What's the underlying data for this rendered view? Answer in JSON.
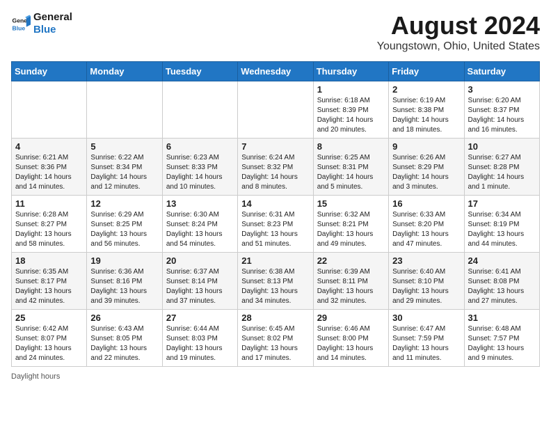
{
  "logo": {
    "line1": "General",
    "line2": "Blue"
  },
  "title": "August 2024",
  "location": "Youngstown, Ohio, United States",
  "weekdays": [
    "Sunday",
    "Monday",
    "Tuesday",
    "Wednesday",
    "Thursday",
    "Friday",
    "Saturday"
  ],
  "footer_label": "Daylight hours",
  "weeks": [
    [
      {
        "day": "",
        "info": ""
      },
      {
        "day": "",
        "info": ""
      },
      {
        "day": "",
        "info": ""
      },
      {
        "day": "",
        "info": ""
      },
      {
        "day": "1",
        "info": "Sunrise: 6:18 AM\nSunset: 8:39 PM\nDaylight: 14 hours\nand 20 minutes."
      },
      {
        "day": "2",
        "info": "Sunrise: 6:19 AM\nSunset: 8:38 PM\nDaylight: 14 hours\nand 18 minutes."
      },
      {
        "day": "3",
        "info": "Sunrise: 6:20 AM\nSunset: 8:37 PM\nDaylight: 14 hours\nand 16 minutes."
      }
    ],
    [
      {
        "day": "4",
        "info": "Sunrise: 6:21 AM\nSunset: 8:36 PM\nDaylight: 14 hours\nand 14 minutes."
      },
      {
        "day": "5",
        "info": "Sunrise: 6:22 AM\nSunset: 8:34 PM\nDaylight: 14 hours\nand 12 minutes."
      },
      {
        "day": "6",
        "info": "Sunrise: 6:23 AM\nSunset: 8:33 PM\nDaylight: 14 hours\nand 10 minutes."
      },
      {
        "day": "7",
        "info": "Sunrise: 6:24 AM\nSunset: 8:32 PM\nDaylight: 14 hours\nand 8 minutes."
      },
      {
        "day": "8",
        "info": "Sunrise: 6:25 AM\nSunset: 8:31 PM\nDaylight: 14 hours\nand 5 minutes."
      },
      {
        "day": "9",
        "info": "Sunrise: 6:26 AM\nSunset: 8:29 PM\nDaylight: 14 hours\nand 3 minutes."
      },
      {
        "day": "10",
        "info": "Sunrise: 6:27 AM\nSunset: 8:28 PM\nDaylight: 14 hours\nand 1 minute."
      }
    ],
    [
      {
        "day": "11",
        "info": "Sunrise: 6:28 AM\nSunset: 8:27 PM\nDaylight: 13 hours\nand 58 minutes."
      },
      {
        "day": "12",
        "info": "Sunrise: 6:29 AM\nSunset: 8:25 PM\nDaylight: 13 hours\nand 56 minutes."
      },
      {
        "day": "13",
        "info": "Sunrise: 6:30 AM\nSunset: 8:24 PM\nDaylight: 13 hours\nand 54 minutes."
      },
      {
        "day": "14",
        "info": "Sunrise: 6:31 AM\nSunset: 8:23 PM\nDaylight: 13 hours\nand 51 minutes."
      },
      {
        "day": "15",
        "info": "Sunrise: 6:32 AM\nSunset: 8:21 PM\nDaylight: 13 hours\nand 49 minutes."
      },
      {
        "day": "16",
        "info": "Sunrise: 6:33 AM\nSunset: 8:20 PM\nDaylight: 13 hours\nand 47 minutes."
      },
      {
        "day": "17",
        "info": "Sunrise: 6:34 AM\nSunset: 8:19 PM\nDaylight: 13 hours\nand 44 minutes."
      }
    ],
    [
      {
        "day": "18",
        "info": "Sunrise: 6:35 AM\nSunset: 8:17 PM\nDaylight: 13 hours\nand 42 minutes."
      },
      {
        "day": "19",
        "info": "Sunrise: 6:36 AM\nSunset: 8:16 PM\nDaylight: 13 hours\nand 39 minutes."
      },
      {
        "day": "20",
        "info": "Sunrise: 6:37 AM\nSunset: 8:14 PM\nDaylight: 13 hours\nand 37 minutes."
      },
      {
        "day": "21",
        "info": "Sunrise: 6:38 AM\nSunset: 8:13 PM\nDaylight: 13 hours\nand 34 minutes."
      },
      {
        "day": "22",
        "info": "Sunrise: 6:39 AM\nSunset: 8:11 PM\nDaylight: 13 hours\nand 32 minutes."
      },
      {
        "day": "23",
        "info": "Sunrise: 6:40 AM\nSunset: 8:10 PM\nDaylight: 13 hours\nand 29 minutes."
      },
      {
        "day": "24",
        "info": "Sunrise: 6:41 AM\nSunset: 8:08 PM\nDaylight: 13 hours\nand 27 minutes."
      }
    ],
    [
      {
        "day": "25",
        "info": "Sunrise: 6:42 AM\nSunset: 8:07 PM\nDaylight: 13 hours\nand 24 minutes."
      },
      {
        "day": "26",
        "info": "Sunrise: 6:43 AM\nSunset: 8:05 PM\nDaylight: 13 hours\nand 22 minutes."
      },
      {
        "day": "27",
        "info": "Sunrise: 6:44 AM\nSunset: 8:03 PM\nDaylight: 13 hours\nand 19 minutes."
      },
      {
        "day": "28",
        "info": "Sunrise: 6:45 AM\nSunset: 8:02 PM\nDaylight: 13 hours\nand 17 minutes."
      },
      {
        "day": "29",
        "info": "Sunrise: 6:46 AM\nSunset: 8:00 PM\nDaylight: 13 hours\nand 14 minutes."
      },
      {
        "day": "30",
        "info": "Sunrise: 6:47 AM\nSunset: 7:59 PM\nDaylight: 13 hours\nand 11 minutes."
      },
      {
        "day": "31",
        "info": "Sunrise: 6:48 AM\nSunset: 7:57 PM\nDaylight: 13 hours\nand 9 minutes."
      }
    ]
  ]
}
